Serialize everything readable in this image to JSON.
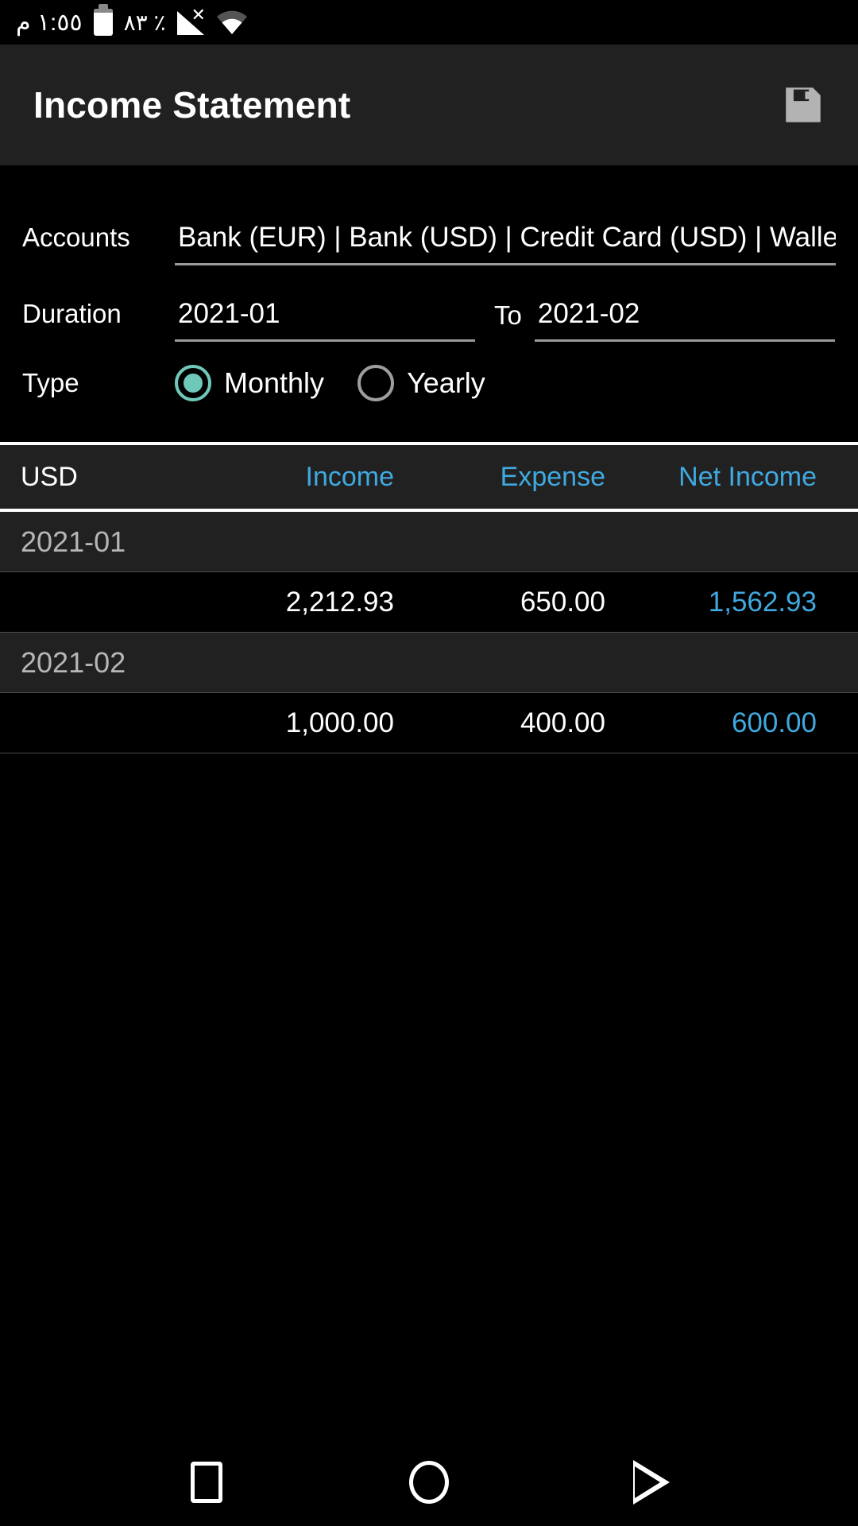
{
  "status_bar": {
    "clock": "١:٥٥ م",
    "battery_percent": "٪ ٨٣",
    "battery_icon": "battery-icon",
    "signal_icon": "no-sim-signal-icon",
    "wifi_icon": "wifi-icon"
  },
  "app_bar": {
    "title": "Income Statement",
    "save_icon": "save-floppy-icon"
  },
  "filters": {
    "accounts_label": "Accounts",
    "accounts_value": "Bank (EUR) | Bank (USD) | Credit Card (USD) | Wallet (US",
    "duration_label": "Duration",
    "duration_from": "2021-01",
    "to_label": "To",
    "duration_to": "2021-02",
    "type_label": "Type",
    "type_options": [
      {
        "label": "Monthly",
        "selected": true
      },
      {
        "label": "Yearly",
        "selected": false
      }
    ],
    "selected_type": "Monthly"
  },
  "table": {
    "currency_header": "USD",
    "columns": [
      "Income",
      "Expense",
      "Net Income"
    ],
    "groups": [
      {
        "period": "2021-01",
        "income": "2,212.93",
        "expense": "650.00",
        "net_income": "1,562.93"
      },
      {
        "period": "2021-02",
        "income": "1,000.00",
        "expense": "400.00",
        "net_income": "600.00"
      }
    ]
  },
  "nav_bar": {
    "recents_icon": "square-recents-icon",
    "home_icon": "circle-home-icon",
    "back_icon": "triangle-back-icon"
  },
  "colors": {
    "accent_teal": "#6ec9bb",
    "accent_blue": "#3fa9e0",
    "app_bar_bg": "#212121",
    "page_bg": "#000000"
  }
}
